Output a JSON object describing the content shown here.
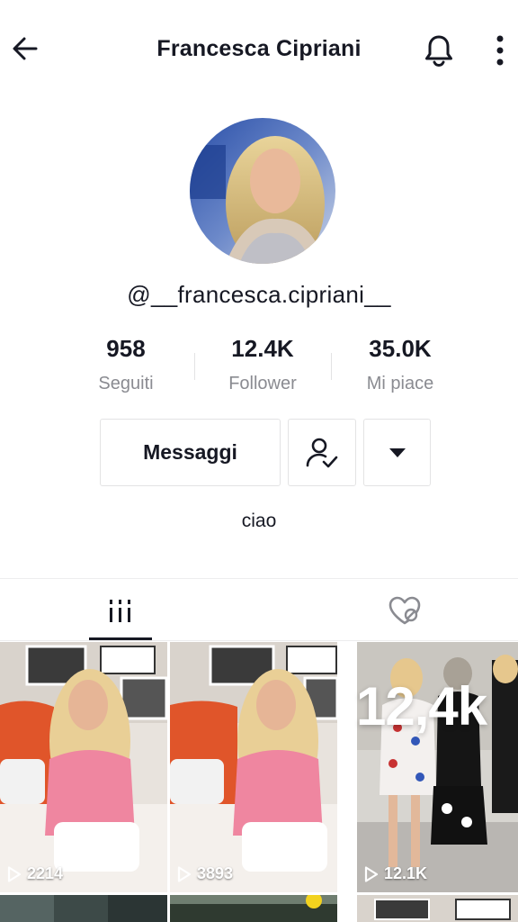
{
  "header": {
    "title": "Francesca Cipriani",
    "back_icon": "arrow-left-icon",
    "bell_icon": "bell-icon",
    "more_icon": "more-vertical-icon"
  },
  "profile": {
    "username": "@__francesca.cipriani__",
    "bio": "ciao",
    "stats": [
      {
        "value": "958",
        "label": "Seguiti"
      },
      {
        "value": "12.4K",
        "label": "Follower"
      },
      {
        "value": "35.0K",
        "label": "Mi piace"
      }
    ]
  },
  "actions": {
    "message_label": "Messaggi",
    "follow_icon": "user-check-icon",
    "dropdown_icon": "caret-down-icon"
  },
  "tabs": [
    {
      "name": "videos",
      "icon": "grid-icon",
      "active": true
    },
    {
      "name": "liked",
      "icon": "heart-hidden-icon",
      "active": false
    }
  ],
  "videos": [
    {
      "views": "2214"
    },
    {
      "views": "3893"
    },
    {
      "views": "12.1K",
      "overlay_text": "12,4k"
    }
  ],
  "colors": {
    "text": "#161823",
    "muted": "#8a8b91",
    "border": "#e3e3e4"
  }
}
